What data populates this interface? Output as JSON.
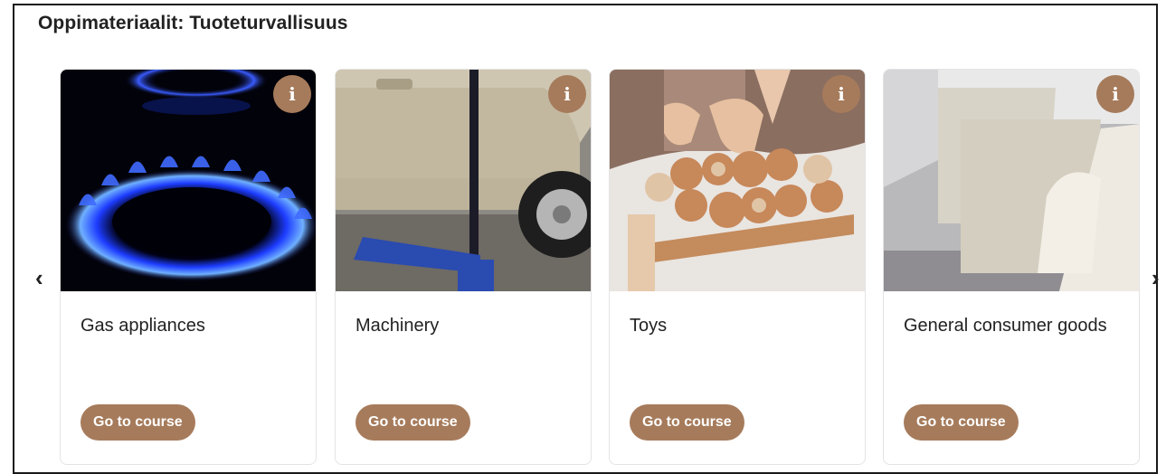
{
  "section": {
    "title": "Oppimateriaalit: Tuoteturvallisuus"
  },
  "carousel": {
    "prev_icon": "chevron-left-icon",
    "next_icon": "chevron-right-icon"
  },
  "cards": [
    {
      "title": "Gas appliances",
      "button": "Go to course",
      "info": "i",
      "image": "gas-burner-flame"
    },
    {
      "title": "Machinery",
      "button": "Go to course",
      "info": "i",
      "image": "car-on-hydraulic-jack"
    },
    {
      "title": "Toys",
      "button": "Go to course",
      "info": "i",
      "image": "child-with-wooden-toys"
    },
    {
      "title": "General consumer goods",
      "button": "Go to course",
      "info": "i",
      "image": "sofa-with-cushions"
    }
  ],
  "colors": {
    "accent": "#a67b5b",
    "text": "#222222",
    "border": "#e4e4e4"
  }
}
